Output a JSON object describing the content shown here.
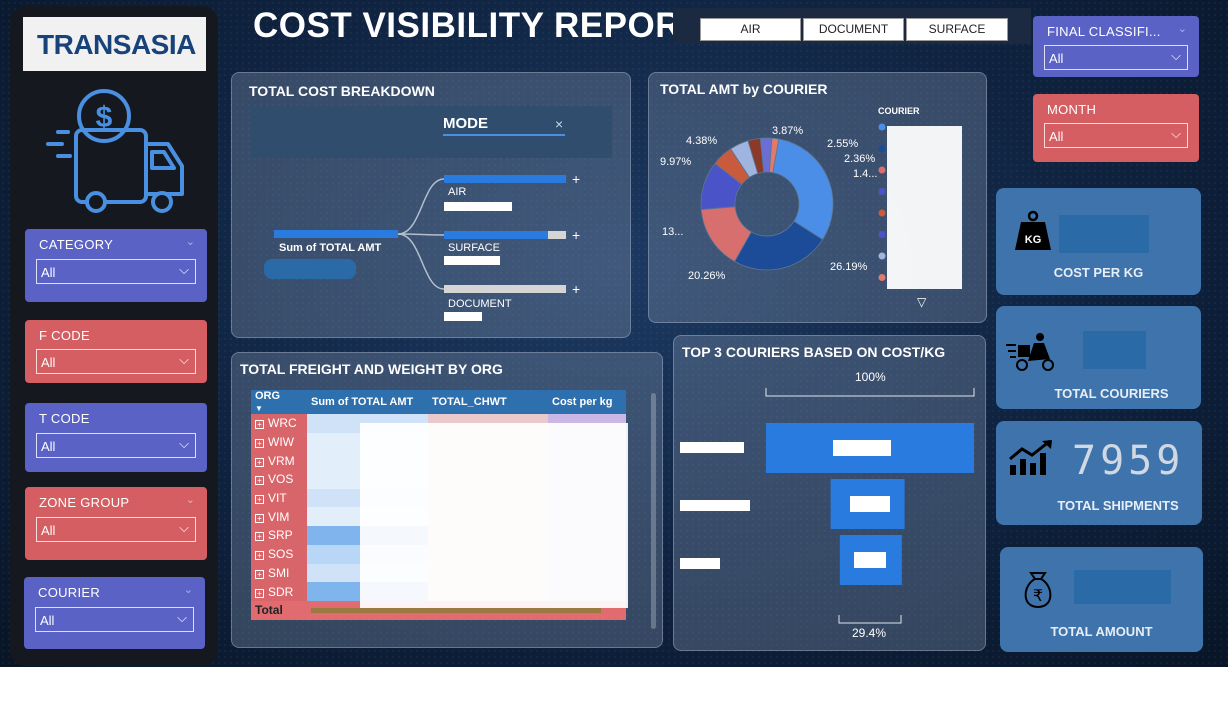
{
  "title": "COST VISIBILITY REPORT",
  "logo_text": "TRANSASIA",
  "mode_buttons": [
    "AIR",
    "DOCUMENT",
    "SURFACE"
  ],
  "slicers": {
    "category": {
      "label": "CATEGORY",
      "value": "All"
    },
    "f_code": {
      "label": "F CODE",
      "value": "All"
    },
    "t_code": {
      "label": "T CODE",
      "value": "All"
    },
    "zone_group": {
      "label": "ZONE GROUP",
      "value": "All"
    },
    "courier": {
      "label": "COURIER",
      "value": "All"
    },
    "final_class": {
      "label": "FINAL CLASSIFI...",
      "value": "All"
    },
    "month": {
      "label": "MONTH",
      "value": "All"
    }
  },
  "breakdown": {
    "title": "TOTAL COST BREAKDOWN",
    "mode_label": "MODE",
    "root_label": "Sum of TOTAL AMT",
    "branches": [
      {
        "label": "AIR",
        "fill": 1.0
      },
      {
        "label": "SURFACE",
        "fill": 0.85
      },
      {
        "label": "DOCUMENT",
        "fill": 0.0
      }
    ]
  },
  "courier_pie": {
    "title": "TOTAL AMT by COURIER",
    "legend_title": "COURIER",
    "labels": [
      "3.87%",
      "2.55%",
      "2.36%",
      "1.4...",
      "26.19%",
      "20.26%",
      "13...",
      "9.97%",
      "4.38%"
    ]
  },
  "chart_data": {
    "type": "pie",
    "title": "TOTAL AMT by COURIER",
    "values": [
      26.19,
      20.26,
      13,
      9.97,
      4.38,
      3.87,
      2.55,
      2.36,
      1.4
    ],
    "colors": [
      "#4a8ee8",
      "#1c4c98",
      "#d86f6f",
      "#4b53c9",
      "#c85a3e",
      "#9fb4de",
      "#8b3a2a",
      "#6a6fd6",
      "#e07a6a"
    ]
  },
  "org_table": {
    "title": "TOTAL FREIGHT AND WEIGHT BY ORG",
    "headers": [
      "ORG",
      "Sum of TOTAL AMT",
      "TOTAL_CHWT",
      "Cost per kg"
    ],
    "rows": [
      "WRC",
      "WIW",
      "VRM",
      "VOS",
      "VIT",
      "VIM",
      "SRP",
      "SOS",
      "SMI",
      "SDR"
    ],
    "total_label": "Total"
  },
  "top_couriers": {
    "title": "TOP 3 COURIERS BASED ON COST/KG",
    "top_pct": "100%",
    "bottom_pct": "29.4%",
    "bars": [
      1.0,
      0.35,
      0.29
    ]
  },
  "kpis": {
    "cost_per_kg": {
      "caption": "COST PER KG",
      "icon_text": "KG"
    },
    "total_couriers": {
      "caption": "TOTAL COURIERS"
    },
    "total_shipments": {
      "caption": "TOTAL SHIPMENTS",
      "value": "7959"
    },
    "total_amount": {
      "caption": "TOTAL AMOUNT",
      "icon_text": "₹"
    }
  }
}
